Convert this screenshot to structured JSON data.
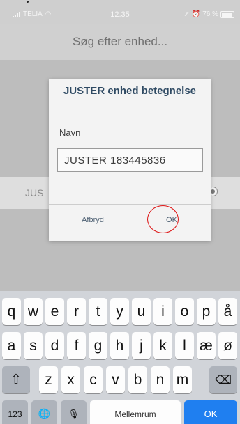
{
  "status_bar": {
    "carrier": "TELIA",
    "time": "12.35",
    "battery_text": "76 %",
    "battery_level": 0.76
  },
  "header": {
    "title": "Søg efter enhed..."
  },
  "list": {
    "row_label": "JUS"
  },
  "dialog": {
    "title": "JUSTER enhed betegnelse",
    "name_label": "Navn",
    "name_value": "JUSTER 183445836",
    "cancel_label": "Afbryd",
    "ok_label": "OK",
    "highlight_color": "#dd1111"
  },
  "keyboard": {
    "row1": [
      "q",
      "w",
      "e",
      "r",
      "t",
      "y",
      "u",
      "i",
      "o",
      "p",
      "å"
    ],
    "row2": [
      "a",
      "s",
      "d",
      "f",
      "g",
      "h",
      "j",
      "k",
      "l",
      "æ",
      "ø"
    ],
    "row3": [
      "z",
      "x",
      "c",
      "v",
      "b",
      "n",
      "m"
    ],
    "shift_icon": "⇧",
    "backspace_icon": "⌫",
    "numbers_label": "123",
    "globe_icon": "🌐",
    "mic_icon": "🎙",
    "space_label": "Mellemrum",
    "return_label": "OK",
    "accent_color": "#1f7ff0"
  }
}
